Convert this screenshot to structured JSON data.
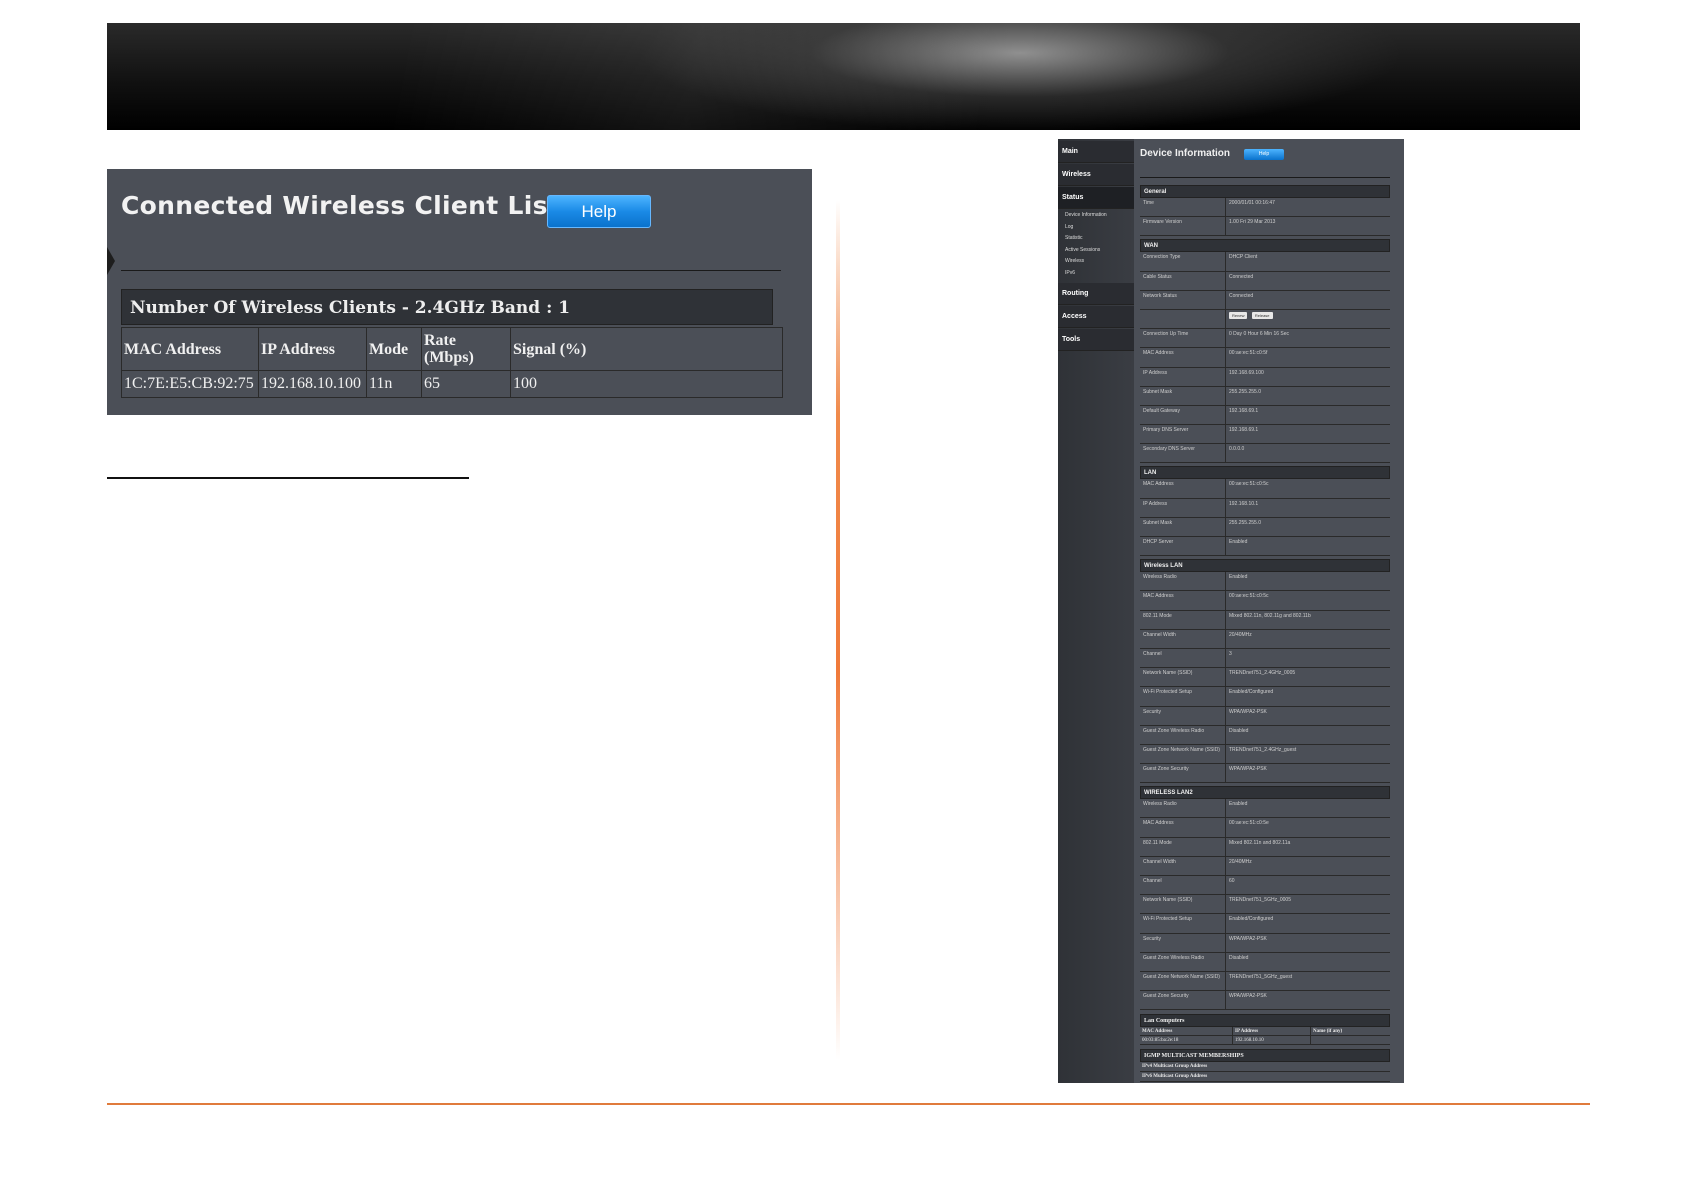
{
  "client_list": {
    "title": "Connected Wireless Client List",
    "help_label": "Help",
    "band_label": "Number Of Wireless Clients - 2.4GHz Band : 1",
    "columns": [
      "MAC Address",
      "IP Address",
      "Mode",
      "Rate (Mbps)",
      "Signal (%)"
    ],
    "rows": [
      [
        "1C:7E:E5:CB:92:75",
        "192.168.10.100",
        "11n",
        "65",
        "100"
      ]
    ]
  },
  "device": {
    "nav": {
      "main": "Main",
      "wireless": "Wireless",
      "status": "Status",
      "status_items": [
        "Device Information",
        "Log",
        "Statistic",
        "Active Sessions",
        "Wireless",
        "IPv6"
      ],
      "routing": "Routing",
      "access": "Access",
      "tools": "Tools"
    },
    "title": "Device Information",
    "help_label": "Help",
    "general": {
      "heading": "General",
      "rows": [
        {
          "k": "Time",
          "v": "2000/01/01 00:16:47"
        },
        {
          "k": "Firmware Version",
          "v": "1.00 Fri 29 Mar 2013"
        }
      ]
    },
    "wan": {
      "heading": "WAN",
      "rows_a": [
        {
          "k": "Connection Type",
          "v": "DHCP Client"
        },
        {
          "k": "Cable Status",
          "v": "Connected"
        },
        {
          "k": "Network Status",
          "v": "Connected"
        }
      ],
      "renew_label": "Renew",
      "release_label": "Release",
      "rows_b": [
        {
          "k": "Connection Up Time",
          "v": "0 Day 0 Hour 6 Min 16 Sec"
        },
        {
          "k": "MAC Address",
          "v": "00:ae:ec:51:c0:5f"
        },
        {
          "k": "IP Address",
          "v": "192.168.69.100"
        },
        {
          "k": "Subnet Mask",
          "v": "255.255.255.0"
        },
        {
          "k": "Default Gateway",
          "v": "192.168.69.1"
        },
        {
          "k": "Primary DNS Server",
          "v": "192.168.69.1"
        },
        {
          "k": "Secondary DNS Server",
          "v": "0.0.0.0"
        }
      ]
    },
    "lan": {
      "heading": "LAN",
      "rows": [
        {
          "k": "MAC Address",
          "v": "00:ae:ec:51:c0:5c"
        },
        {
          "k": "IP Address",
          "v": "192.168.10.1"
        },
        {
          "k": "Subnet Mask",
          "v": "255.255.255.0"
        },
        {
          "k": "DHCP Server",
          "v": "Enabled"
        }
      ]
    },
    "wlan": {
      "heading": "Wireless LAN",
      "rows": [
        {
          "k": "Wireless Radio",
          "v": "Enabled"
        },
        {
          "k": "MAC Address",
          "v": "00:ae:ec:51:c0:5c"
        },
        {
          "k": "802.11 Mode",
          "v": "Mixed 802.11n, 802.11g and 802.11b"
        },
        {
          "k": "Channel Width",
          "v": "20/40MHz"
        },
        {
          "k": "Channel",
          "v": "3"
        },
        {
          "k": "Network Name (SSID)",
          "v": "TRENDnet751_2.4GHz_0005"
        },
        {
          "k": "Wi-Fi Protected Setup",
          "v": "Enabled/Configured"
        },
        {
          "k": "Security",
          "v": "WPA/WPA2-PSK"
        },
        {
          "k": "Guest Zone Wireless Radio",
          "v": "Disabled"
        },
        {
          "k": "Guest Zone Network Name (SSID)",
          "v": "TRENDnet751_2.4GHz_guest"
        },
        {
          "k": "Guest Zone Security",
          "v": "WPA/WPA2-PSK"
        }
      ]
    },
    "wlan2": {
      "heading": "WIRELESS LAN2",
      "rows": [
        {
          "k": "Wireless Radio",
          "v": "Enabled"
        },
        {
          "k": "MAC Address",
          "v": "00:ae:ec:51:c0:5e"
        },
        {
          "k": "802.11 Mode",
          "v": "Mixed 802.11n and 802.11a"
        },
        {
          "k": "Channel Width",
          "v": "20/40MHz"
        },
        {
          "k": "Channel",
          "v": "60"
        },
        {
          "k": "Network Name (SSID)",
          "v": "TRENDnet751_5GHz_0005"
        },
        {
          "k": "Wi-Fi Protected Setup",
          "v": "Enabled/Configured"
        },
        {
          "k": "Security",
          "v": "WPA/WPA2-PSK"
        },
        {
          "k": "Guest Zone Wireless Radio",
          "v": "Disabled"
        },
        {
          "k": "Guest Zone Network Name (SSID)",
          "v": "TRENDnet751_5GHz_guest"
        },
        {
          "k": "Guest Zone Security",
          "v": "WPA/WPA2-PSK"
        }
      ]
    },
    "lan_computers": {
      "heading": "Lan Computers",
      "columns": [
        "MAC Address",
        "IP Address",
        "Name (if any)"
      ],
      "rows": [
        [
          "00:03:85:ba:2e:18",
          "192.168.10.10",
          ""
        ]
      ]
    },
    "igmp": {
      "heading": "IGMP MULTICAST MEMBERSHIPS",
      "ipv4_label": "IPv4 Multicast Group Address",
      "ipv6_label": "IPv6 Multicast Group Address"
    }
  }
}
